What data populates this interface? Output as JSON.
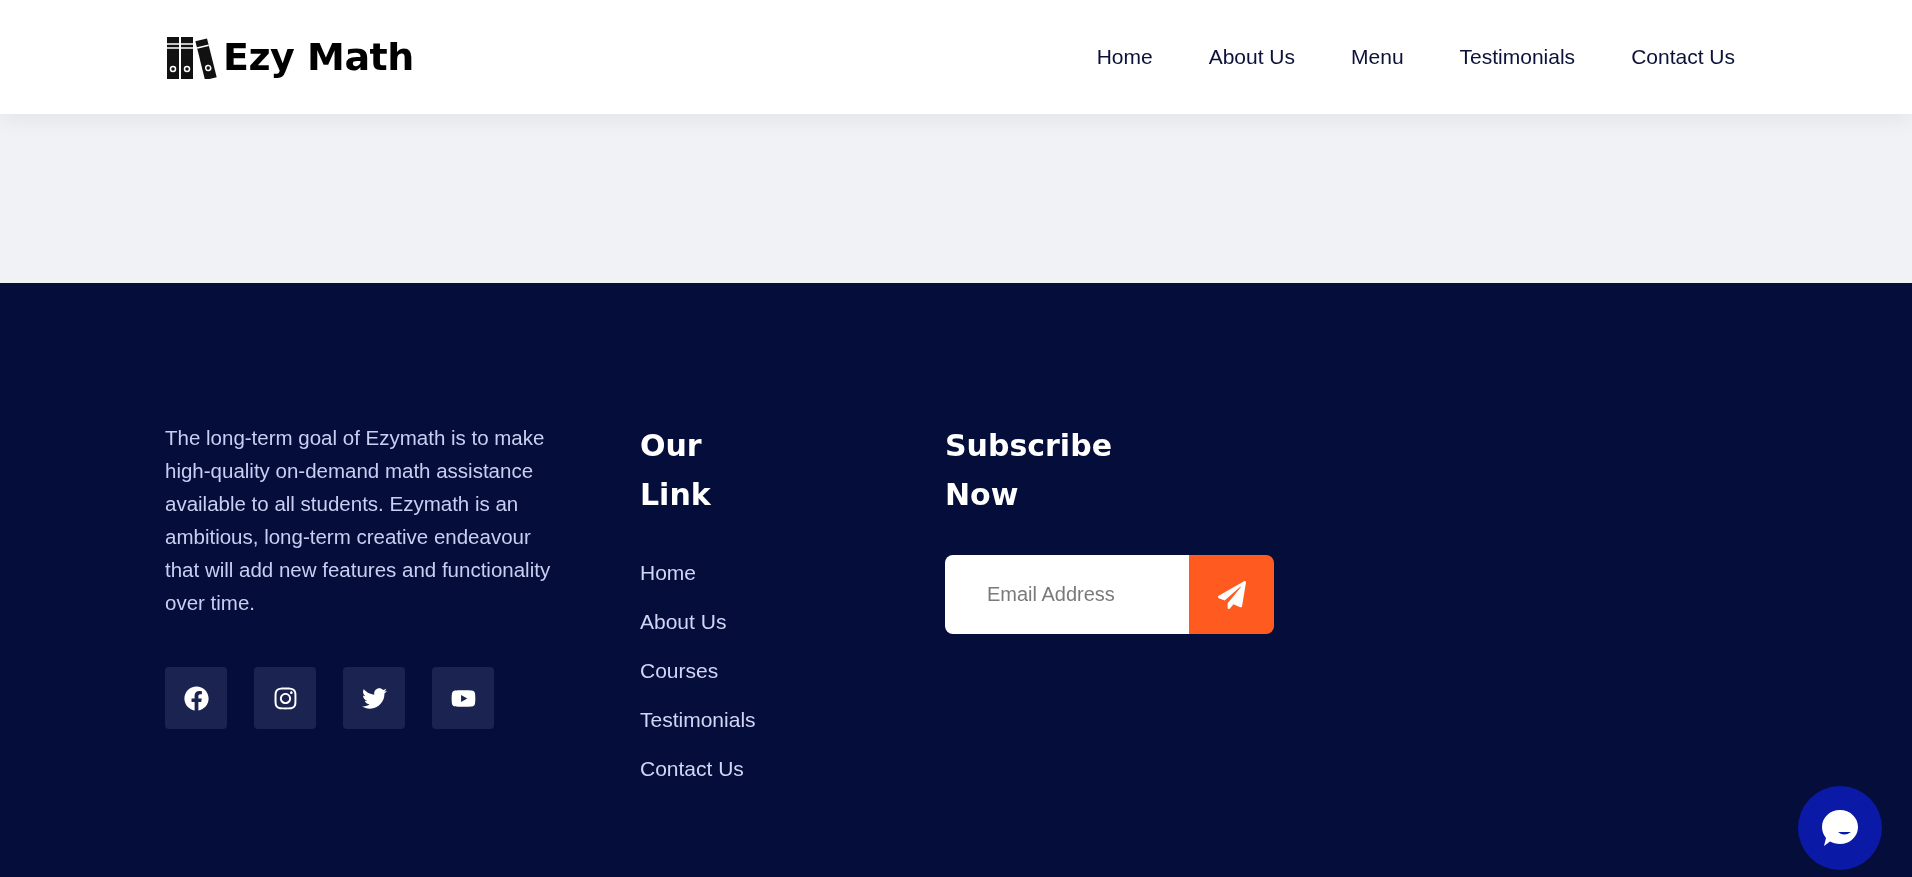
{
  "header": {
    "logo": {
      "text": "Ezy Math"
    },
    "nav": [
      {
        "label": "Home"
      },
      {
        "label": "About Us"
      },
      {
        "label": "Menu"
      },
      {
        "label": "Testimonials"
      },
      {
        "label": "Contact Us"
      }
    ]
  },
  "footer": {
    "about": "The long-term goal of Ezymath is to make high-quality on-demand math assistance available to all students. Ezymath is an ambitious, long-term creative endeavour that will add new features and functionality over time.",
    "social": [
      {
        "kind": "facebook"
      },
      {
        "kind": "instagram"
      },
      {
        "kind": "twitter"
      },
      {
        "kind": "youtube"
      }
    ],
    "links": {
      "title": "Our Link",
      "items": [
        {
          "label": "Home"
        },
        {
          "label": "About Us"
        },
        {
          "label": "Courses"
        },
        {
          "label": "Testimonials"
        },
        {
          "label": "Contact Us"
        }
      ]
    },
    "subscribe": {
      "title": "Subscribe Now",
      "placeholder": "Email Address"
    }
  }
}
